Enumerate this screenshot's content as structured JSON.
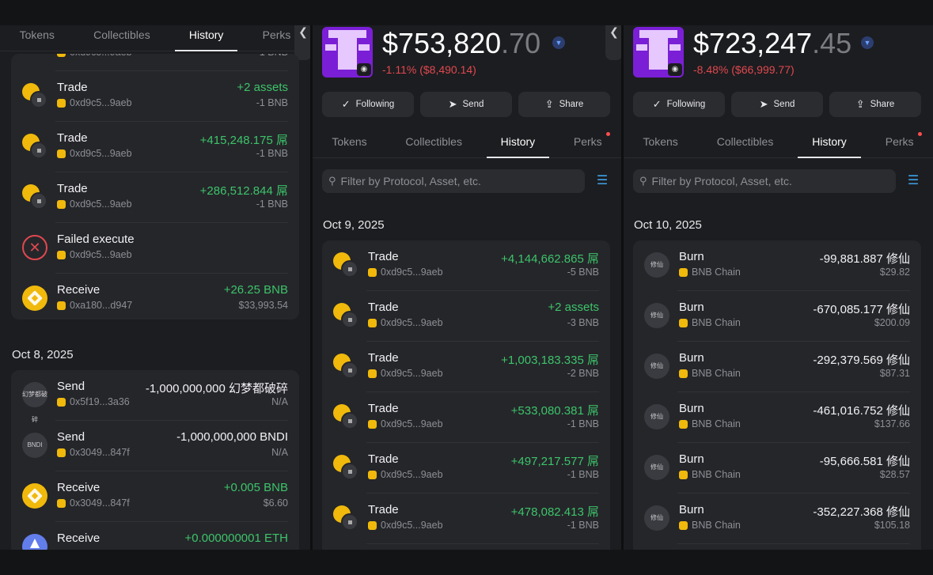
{
  "tabs": [
    "Tokens",
    "Collectibles",
    "History",
    "Perks"
  ],
  "actions": {
    "following": "Following",
    "send": "Send",
    "share": "Share"
  },
  "filter_placeholder": "Filter by Protocol, Asset, etc.",
  "panel1": {
    "cut_row_sub": "0xd9c5...9aeb",
    "cut_row_amt": "-1 BNB",
    "card1": [
      {
        "icon": "trade-icon",
        "title": "Trade",
        "sub": "0xd9c5...9aeb",
        "amt": "+2 assets",
        "amt2": "-1 BNB",
        "pos": true
      },
      {
        "icon": "trade-icon",
        "title": "Trade",
        "sub": "0xd9c5...9aeb",
        "amt": "+415,248.175 屌",
        "amt2": "-1 BNB",
        "pos": true
      },
      {
        "icon": "trade-icon",
        "title": "Trade",
        "sub": "0xd9c5...9aeb",
        "amt": "+286,512.844 屌",
        "amt2": "-1 BNB",
        "pos": true
      },
      {
        "icon": "failed-icon",
        "title": "Failed execute",
        "sub": "0xd9c5...9aeb",
        "amt": "",
        "amt2": "",
        "pos": false
      },
      {
        "icon": "bnb-icon",
        "title": "Receive",
        "sub": "0xa180...d947",
        "amt": "+26.25 BNB",
        "amt2": "$33,993.54",
        "pos": true
      }
    ],
    "date2": "Oct 8, 2025",
    "card2": [
      {
        "icon": "token-icon",
        "badge": "幻梦都破碎",
        "title": "Send",
        "sub": "0x5f19...3a36",
        "amt": "-1,000,000,000 幻梦都破碎",
        "amt2": "N/A",
        "pos": false
      },
      {
        "icon": "token-icon",
        "badge": "BNDI",
        "title": "Send",
        "sub": "0x3049...847f",
        "amt": "-1,000,000,000 BNDI",
        "amt2": "N/A",
        "pos": false
      },
      {
        "icon": "bnb-icon",
        "title": "Receive",
        "sub": "0x3049...847f",
        "amt": "+0.005 BNB",
        "amt2": "$6.60",
        "pos": true
      },
      {
        "icon": "eth-icon",
        "title": "Receive",
        "sub": "",
        "amt": "+0.000000001 ETH",
        "amt2": "",
        "pos": true
      }
    ]
  },
  "panel2": {
    "balance_main": "$753,820",
    "balance_dec": ".70",
    "change": "-1.11% ($8,490.14)",
    "date": "Oct 9, 2025",
    "rows": [
      {
        "title": "Trade",
        "sub": "0xd9c5...9aeb",
        "amt": "+4,144,662.865 屌",
        "amt2": "-5 BNB"
      },
      {
        "title": "Trade",
        "sub": "0xd9c5...9aeb",
        "amt": "+2 assets",
        "amt2": "-3 BNB"
      },
      {
        "title": "Trade",
        "sub": "0xd9c5...9aeb",
        "amt": "+1,003,183.335 屌",
        "amt2": "-2 BNB"
      },
      {
        "title": "Trade",
        "sub": "0xd9c5...9aeb",
        "amt": "+533,080.381 屌",
        "amt2": "-1 BNB"
      },
      {
        "title": "Trade",
        "sub": "0xd9c5...9aeb",
        "amt": "+497,217.577 屌",
        "amt2": "-1 BNB"
      },
      {
        "title": "Trade",
        "sub": "0xd9c5...9aeb",
        "amt": "+478,082.413 屌",
        "amt2": "-1 BNB"
      }
    ]
  },
  "panel3": {
    "balance_main": "$723,247",
    "balance_dec": ".45",
    "change": "-8.48% ($66,999.77)",
    "date": "Oct 10, 2025",
    "badge": "修仙",
    "rows": [
      {
        "title": "Burn",
        "sub": "BNB Chain",
        "amt": "-99,881.887 修仙",
        "amt2": "$29.82"
      },
      {
        "title": "Burn",
        "sub": "BNB Chain",
        "amt": "-670,085.177 修仙",
        "amt2": "$200.09"
      },
      {
        "title": "Burn",
        "sub": "BNB Chain",
        "amt": "-292,379.569 修仙",
        "amt2": "$87.31"
      },
      {
        "title": "Burn",
        "sub": "BNB Chain",
        "amt": "-461,016.752 修仙",
        "amt2": "$137.66"
      },
      {
        "title": "Burn",
        "sub": "BNB Chain",
        "amt": "-95,666.581 修仙",
        "amt2": "$28.57"
      },
      {
        "title": "Burn",
        "sub": "BNB Chain",
        "amt": "-352,227.368 修仙",
        "amt2": "$105.18"
      }
    ]
  }
}
